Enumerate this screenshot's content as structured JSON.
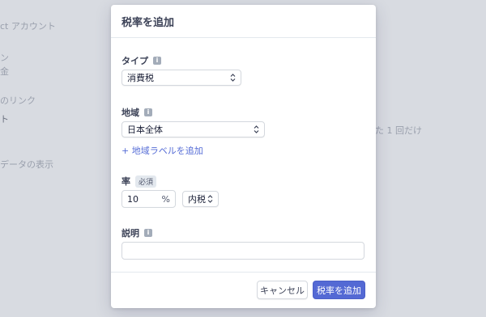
{
  "background": {
    "nav_items": [
      "ct アカウント",
      "ン",
      "金",
      "のリンク",
      "ト",
      "データの表示"
    ],
    "right_text": "た 1 回だけ"
  },
  "modal": {
    "title": "税率を追加",
    "type": {
      "label": "タイプ",
      "value": "消費税"
    },
    "region": {
      "label": "地域",
      "value": "日本全体",
      "add_link": "+ 地域ラベルを追加"
    },
    "rate": {
      "label": "率",
      "badge": "必須",
      "value": "10",
      "suffix": "%",
      "inclusive_value": "内税"
    },
    "description": {
      "label": "説明",
      "value": ""
    },
    "buttons": {
      "cancel": "キャンセル",
      "submit": "税率を追加"
    }
  },
  "colors": {
    "accent": "#5469d4",
    "link": "#556cd6"
  }
}
